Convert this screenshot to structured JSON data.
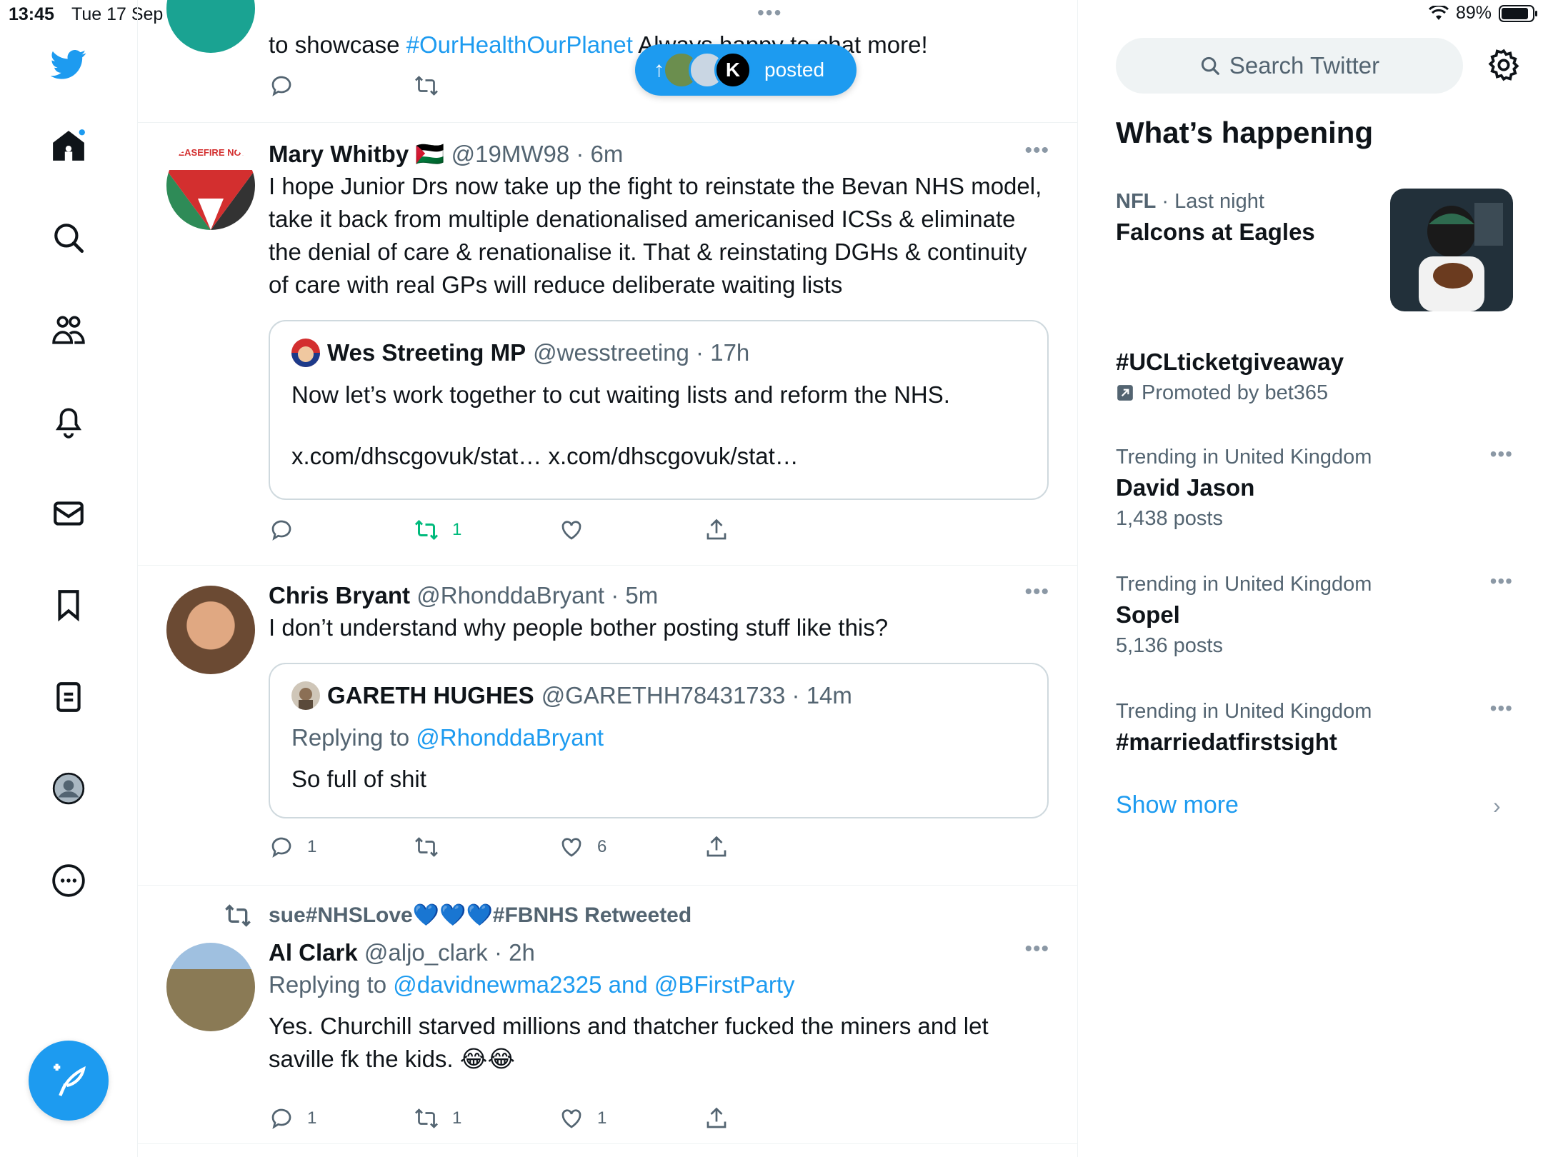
{
  "status_bar": {
    "time": "13:45",
    "date": "Tue 17 Sep",
    "battery": "89%",
    "battery_level": 0.89
  },
  "new_posts_pill": {
    "label": "posted"
  },
  "timeline": {
    "top_tweet_partial": {
      "text_before": "to showcase ",
      "hashtag": "#OurHealthOurPlanet",
      "text_after": " Always happy to chat more!"
    },
    "tweets": [
      {
        "name": "Mary Whitby",
        "flag": "🇵🇸",
        "handle": "@19MW98",
        "time": "6m",
        "text": "I hope Junior Drs now take up the fight to reinstate the Bevan NHS model, take it back from multiple denationalised americanised ICSs & eliminate the denial of care & renationalise it. That & reinstating DGHs & continuity of care with real GPs will reduce deliberate waiting lists",
        "avatar_text": "CEASEFIRE NOW",
        "quote": {
          "name": "Wes Streeting MP",
          "handle": "@wesstreeting",
          "time": "17h",
          "text": "Now let’s work together to cut waiting lists and reform the NHS.",
          "links": "x.com/dhscgovuk/stat… x.com/dhscgovuk/stat…"
        },
        "retweet_count": "1"
      },
      {
        "name": "Chris Bryant",
        "handle": "@RhonddaBryant",
        "time": "5m",
        "text": "I don’t understand why people bother posting stuff like this?",
        "quote": {
          "name": "GARETH HUGHES",
          "handle": "@GARETHH78431733",
          "time": "14m",
          "replying_label": "Replying to ",
          "replying_to": "@RhonddaBryant",
          "text": "So full of shit"
        },
        "reply_count": "1",
        "like_count": "6"
      },
      {
        "retweeted_by": "sue#NHSLove💙💙💙#FBNHS Retweeted",
        "name": "Al Clark",
        "handle": "@aljo_clark",
        "time": "2h",
        "replying_label": "Replying to ",
        "replying_to": "@davidnewma2325 and @BFirstParty",
        "text": "Yes. Churchill starved millions and thatcher fucked the miners and let saville fk the kids. 😂😂",
        "reply_count": "1",
        "retweet_count": "1",
        "like_count": "1"
      }
    ]
  },
  "sidebar": {
    "search_placeholder": "Search Twitter",
    "whats_happening": "What’s happening",
    "trends": [
      {
        "category": "NFL",
        "meta": " · Last night",
        "topic": "Falcons at Eagles"
      },
      {
        "topic": "#UCLticketgiveaway",
        "promoted": "Promoted by bet365"
      },
      {
        "meta": "Trending in United Kingdom",
        "topic": "David Jason",
        "count": "1,438 posts"
      },
      {
        "meta": "Trending in United Kingdom",
        "topic": "Sopel",
        "count": "5,136 posts"
      },
      {
        "meta": "Trending in United Kingdom",
        "topic": "#marriedatfirstsight"
      }
    ],
    "show_more": "Show more"
  },
  "icons": {
    "nav": [
      "twitter-logo-icon",
      "home-icon",
      "search-icon",
      "communities-icon",
      "notifications-icon",
      "messages-icon",
      "bookmarks-icon",
      "lists-icon",
      "profile-icon",
      "more-icon"
    ],
    "compose": "compose-icon"
  },
  "colors": {
    "accent": "#1d9bf0",
    "retweet_green": "#00ba7c",
    "secondary_text": "#536471",
    "border": "#eff3f4"
  }
}
